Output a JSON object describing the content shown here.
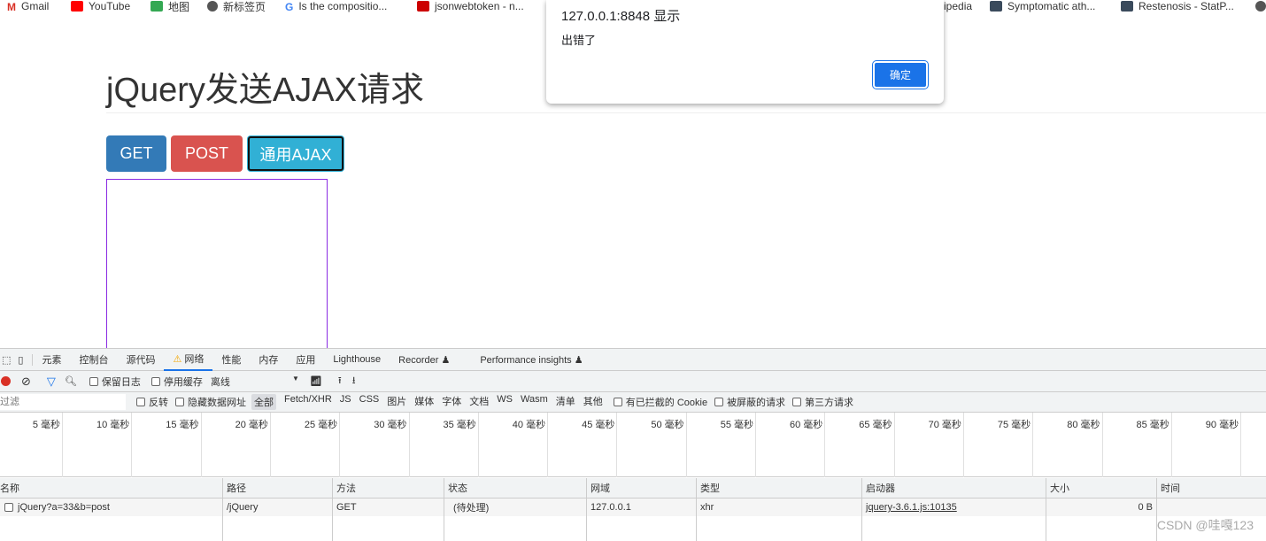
{
  "bookmarks": [
    "Gmail",
    "YouTube",
    "地图",
    "新标签页",
    "Is the compositio...",
    "jsonwebtoken - n...",
    "ipedia",
    "Symptomatic ath...",
    "Restenosis - StatP..."
  ],
  "page": {
    "title": "jQuery发送AJAX请求",
    "buttons": {
      "get": "GET",
      "post": "POST",
      "ajax": "通用AJAX"
    },
    "colors": {
      "get": "#337ab7",
      "post": "#d9534f",
      "ajax": "#31b0d5",
      "box_border": "#8a2be2"
    }
  },
  "dialog": {
    "title": "127.0.0.1:8848 显示",
    "message": "出错了",
    "ok": "确定"
  },
  "devtools": {
    "tabs": [
      "元素",
      "控制台",
      "源代码",
      "网络",
      "性能",
      "内存",
      "应用",
      "Lighthouse",
      "Recorder ♟",
      "Performance insights ♟"
    ],
    "active_tab": "网络",
    "toolbar": {
      "preserve_log": "保留日志",
      "disable_cache": "停用缓存",
      "throttle": "离线"
    },
    "filter": {
      "placeholder": "过滤",
      "invert": "反转",
      "hide_data_urls": "隐藏数据网址",
      "types": [
        "全部",
        "Fetch/XHR",
        "JS",
        "CSS",
        "图片",
        "媒体",
        "字体",
        "文档",
        "WS",
        "Wasm",
        "清单",
        "其他"
      ],
      "blocked_cookies": "有已拦截的 Cookie",
      "blocked_requests": "被屏蔽的请求",
      "third_party": "第三方请求"
    },
    "timeline": [
      "5 毫秒",
      "10 毫秒",
      "15 毫秒",
      "20 毫秒",
      "25 毫秒",
      "30 毫秒",
      "35 毫秒",
      "40 毫秒",
      "45 毫秒",
      "50 毫秒",
      "55 毫秒",
      "60 毫秒",
      "65 毫秒",
      "70 毫秒",
      "75 毫秒",
      "80 毫秒",
      "85 毫秒",
      "90 毫秒"
    ],
    "columns": [
      "名称",
      "路径",
      "方法",
      "状态",
      "网域",
      "类型",
      "启动器",
      "大小",
      "时间"
    ],
    "rows": [
      [
        "jQuery?a=33&b=post",
        "/jQuery",
        "GET",
        "(待处理)",
        "127.0.0.1",
        "xhr",
        "jquery-3.6.1.js:10135",
        "0 B",
        ""
      ]
    ]
  },
  "watermark": "CSDN @哇嘎123"
}
